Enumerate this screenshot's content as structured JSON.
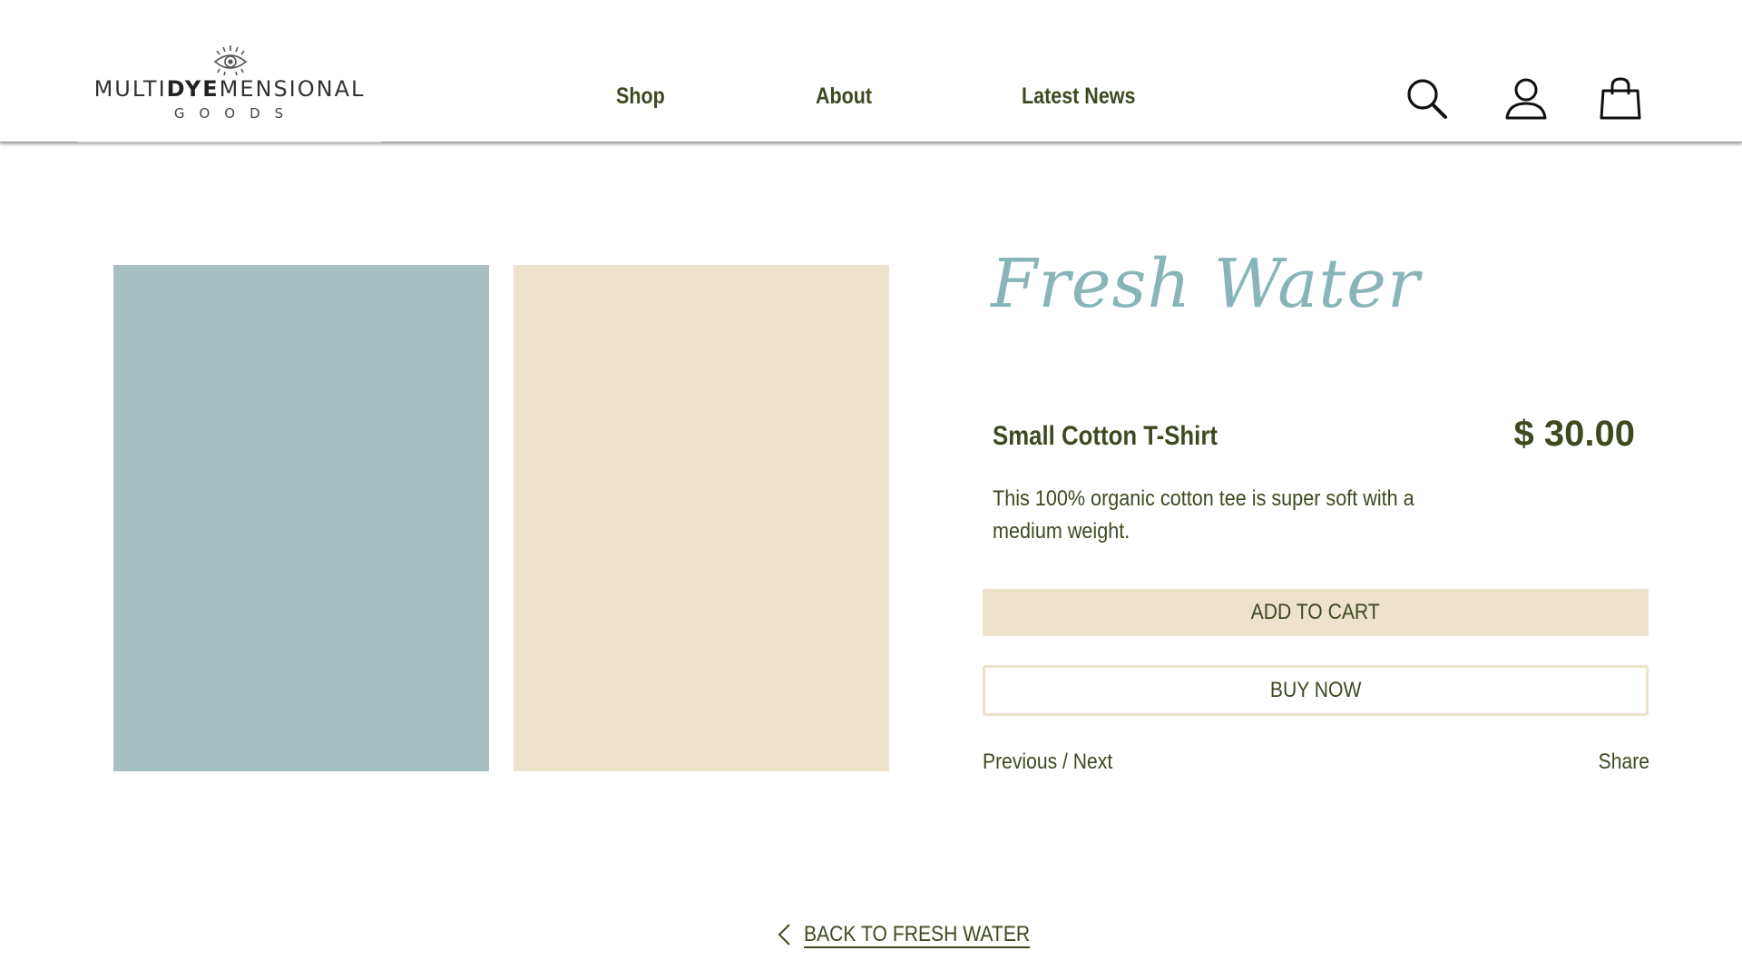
{
  "colors": {
    "text": "#3d4a20",
    "title_script": "#88b6b8",
    "swatch_blue": "#a6c0c1",
    "swatch_cream": "#ede2cb",
    "button_bg": "#ede2cb"
  },
  "logo": {
    "line1_a": "MULTI",
    "line1_b": "DYE",
    "line1_c": "MENSIONAL",
    "line2": "GOODS",
    "icon": "eye-icon"
  },
  "nav": {
    "items": [
      {
        "label": "Shop"
      },
      {
        "label": "About"
      },
      {
        "label": "Latest News"
      }
    ]
  },
  "header_icons": [
    "search-icon",
    "account-icon",
    "cart-bag-icon"
  ],
  "product": {
    "collection_title": "Fresh Water",
    "name": "Small Cotton T-Shirt",
    "price": "$ 30.00",
    "description": "This 100% organic cotton tee is super soft with a medium weight.",
    "add_to_cart": "ADD TO CART",
    "buy_now": "BUY NOW",
    "previous": "Previous",
    "separator": " / ",
    "next": "Next",
    "share": "Share"
  },
  "footer": {
    "back_label": "BACK TO FRESH WATER",
    "back_icon": "chevron-left-icon"
  }
}
